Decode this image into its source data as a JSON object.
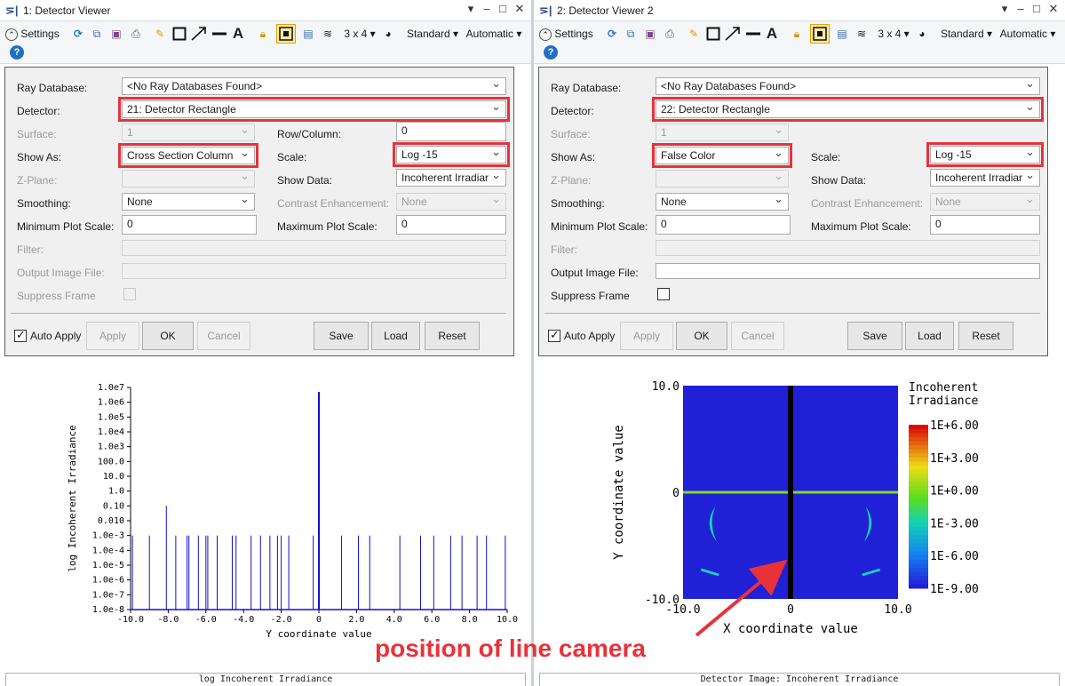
{
  "colors": {
    "highlight": "#e8323a",
    "plot_line": "#1010cc",
    "annotation": "#e8323a"
  },
  "toolbar_common": {
    "settings_label": "Settings",
    "layout_label": "3 x 4 ▾",
    "standard_label": "Standard ▾",
    "automatic_label": "Automatic ▾"
  },
  "labels": {
    "ray_database": "Ray Database:",
    "detector": "Detector:",
    "surface": "Surface:",
    "show_as": "Show As:",
    "z_plane": "Z-Plane:",
    "smoothing": "Smoothing:",
    "min_plot_scale": "Minimum Plot Scale:",
    "filter": "Filter:",
    "output_image_file": "Output Image File:",
    "suppress_frame": "Suppress Frame",
    "row_column": "Row/Column:",
    "scale": "Scale:",
    "show_data": "Show Data:",
    "contrast_enhancement": "Contrast Enhancement:",
    "max_plot_scale": "Maximum Plot Scale:",
    "auto_apply": "Auto Apply",
    "apply": "Apply",
    "ok": "OK",
    "cancel": "Cancel",
    "save": "Save",
    "load": "Load",
    "reset": "Reset"
  },
  "left": {
    "title": "1: Detector Viewer",
    "ray_database": "<No Ray Databases Found>",
    "detector": "21: Detector Rectangle",
    "surface": "1",
    "show_as": "Cross Section Column",
    "z_plane": "",
    "smoothing": "None",
    "min_plot_scale": "0",
    "filter": "",
    "output_image_file": "",
    "row_column": "0",
    "scale": "Log -15",
    "show_data": "Incoherent Irradiar",
    "contrast_enhancement": "None",
    "max_plot_scale": "0",
    "auto_apply_checked": true,
    "suppress_frame_checked": false,
    "footer": "log Incoherent Irradiance"
  },
  "right": {
    "title": "2: Detector Viewer 2",
    "ray_database": "<No Ray Databases Found>",
    "detector": "22: Detector Rectangle",
    "surface": "1",
    "show_as": "False Color",
    "z_plane": "",
    "smoothing": "None",
    "min_plot_scale": "0",
    "filter": "",
    "output_image_file": "",
    "row_column": "",
    "scale": "Log -15",
    "show_data": "Incoherent Irradiar",
    "contrast_enhancement": "None",
    "max_plot_scale": "0",
    "auto_apply_checked": true,
    "suppress_frame_checked": false,
    "footer": "Detector Image: Incoherent Irradiance"
  },
  "chart_data": [
    {
      "type": "line",
      "title": "",
      "xlabel": "Y coordinate value",
      "ylabel": "log Incoherent Irradiance",
      "xlim": [
        -10,
        10
      ],
      "ylim_log10": [
        -8,
        7
      ],
      "y_scale": "log",
      "x_ticks": [
        "-10.0",
        "-8.0",
        "-6.0",
        "-4.0",
        "-2.0",
        "0",
        "2.0",
        "4.0",
        "6.0",
        "8.0",
        "10.0"
      ],
      "y_ticks": [
        "1.0e7",
        "1.0e6",
        "1.0e5",
        "1.0e4",
        "1.0e3",
        "100.0",
        "10.0",
        "1.0",
        "0.10",
        "0.010",
        "1.0e-3",
        "1.0e-4",
        "1.0e-5",
        "1.0e-6",
        "1.0e-7",
        "1.0e-8"
      ],
      "baseline": "1.0e-8",
      "spikes": [
        {
          "x": -9.9,
          "y": "1.0e-3"
        },
        {
          "x": -9.0,
          "y": "1.0e-3"
        },
        {
          "x": -8.1,
          "y": "1.0e-1"
        },
        {
          "x": -7.6,
          "y": "1.0e-3"
        },
        {
          "x": -7.0,
          "y": "1.0e-3"
        },
        {
          "x": -6.9,
          "y": "1.0e-3"
        },
        {
          "x": -6.4,
          "y": "1.0e-3"
        },
        {
          "x": -6.0,
          "y": "1.0e-3"
        },
        {
          "x": -5.9,
          "y": "1.0e-3"
        },
        {
          "x": -5.4,
          "y": "1.0e-3"
        },
        {
          "x": -4.6,
          "y": "1.0e-3"
        },
        {
          "x": -4.4,
          "y": "1.0e-3"
        },
        {
          "x": -3.6,
          "y": "1.0e-3"
        },
        {
          "x": -3.1,
          "y": "1.0e-3"
        },
        {
          "x": -2.6,
          "y": "1.0e-3"
        },
        {
          "x": -2.2,
          "y": "1.0e-3"
        },
        {
          "x": -2.0,
          "y": "1.0e-3"
        },
        {
          "x": -1.6,
          "y": "1.0e-3"
        },
        {
          "x": -0.3,
          "y": "1.0e-3"
        },
        {
          "x": 0.0,
          "y": "5.0e6"
        },
        {
          "x": 1.2,
          "y": "1.0e-3"
        },
        {
          "x": 2.1,
          "y": "1.0e-3"
        },
        {
          "x": 2.7,
          "y": "1.0e-3"
        },
        {
          "x": 4.3,
          "y": "1.0e-3"
        },
        {
          "x": 5.4,
          "y": "1.0e-3"
        },
        {
          "x": 6.1,
          "y": "1.0e-3"
        },
        {
          "x": 7.0,
          "y": "1.0e-3"
        },
        {
          "x": 7.6,
          "y": "1.0e-3"
        },
        {
          "x": 8.4,
          "y": "1.0e-3"
        },
        {
          "x": 8.9,
          "y": "1.0e-3"
        },
        {
          "x": 9.9,
          "y": "1.0e-3"
        }
      ]
    },
    {
      "type": "heatmap",
      "title": "",
      "xlabel": "X coordinate value",
      "ylabel": "Y coordinate value",
      "x_ticks": [
        "-10.0",
        "0",
        "10.0"
      ],
      "y_ticks": [
        "10.0",
        "0",
        "-10.0"
      ],
      "xlim": [
        -10,
        10
      ],
      "ylim": [
        -10,
        10
      ],
      "colorbar_title": [
        "Incoherent",
        "Irradiance"
      ],
      "colorbar_ticks": [
        "1E+6.00",
        "1E+3.00",
        "1E+0.00",
        "1E-3.00",
        "1E-6.00",
        "1E-9.00"
      ],
      "background_level": "1E-9.00",
      "features": [
        {
          "name": "horizontal line",
          "y": 0,
          "level": "1E+0.00"
        },
        {
          "name": "left arc",
          "x": -7.5,
          "y": -3,
          "level": "1E-3.00"
        },
        {
          "name": "right arc",
          "x": 7.5,
          "y": -3,
          "level": "1E-3.00"
        },
        {
          "name": "left dash",
          "x": -7.5,
          "y": -7.5,
          "level": "1E-3.00"
        },
        {
          "name": "right dash",
          "x": 7.5,
          "y": -7.5,
          "level": "1E-3.00"
        },
        {
          "name": "black column",
          "x": 0,
          "level": "none"
        }
      ]
    }
  ],
  "annotation": "position of line camera"
}
